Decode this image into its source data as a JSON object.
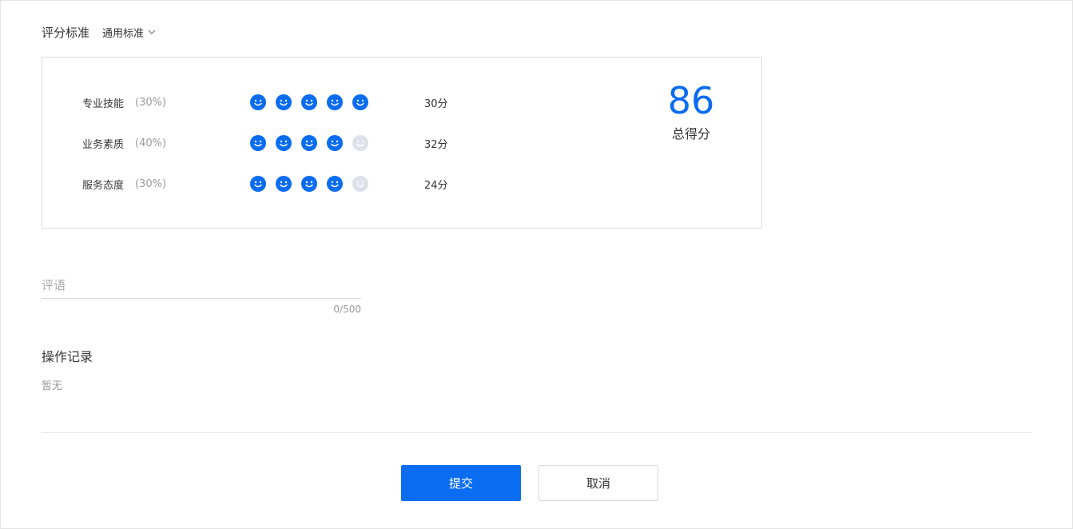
{
  "standard": {
    "label": "评分标准",
    "selected": "通用标准"
  },
  "criteria": [
    {
      "name": "专业技能",
      "weight": "(30%)",
      "rating": 5,
      "max": 5,
      "score": "30分"
    },
    {
      "name": "业务素质",
      "weight": "(40%)",
      "rating": 4,
      "max": 5,
      "score": "32分"
    },
    {
      "name": "服务态度",
      "weight": "(30%)",
      "rating": 4,
      "max": 5,
      "score": "24分"
    }
  ],
  "total": {
    "value": "86",
    "label": "总得分"
  },
  "comment": {
    "placeholder": "评语",
    "value": "",
    "counter": "0/500"
  },
  "log": {
    "title": "操作记录",
    "empty": "暂无"
  },
  "actions": {
    "submit": "提交",
    "cancel": "取消"
  },
  "colors": {
    "accent": "#0a6cf0",
    "inactive": "#dde2ea"
  },
  "icons": {
    "face_active": "smile-face-icon",
    "face_inactive": "smile-face-icon-inactive",
    "dropdown": "chevron-down-icon"
  }
}
